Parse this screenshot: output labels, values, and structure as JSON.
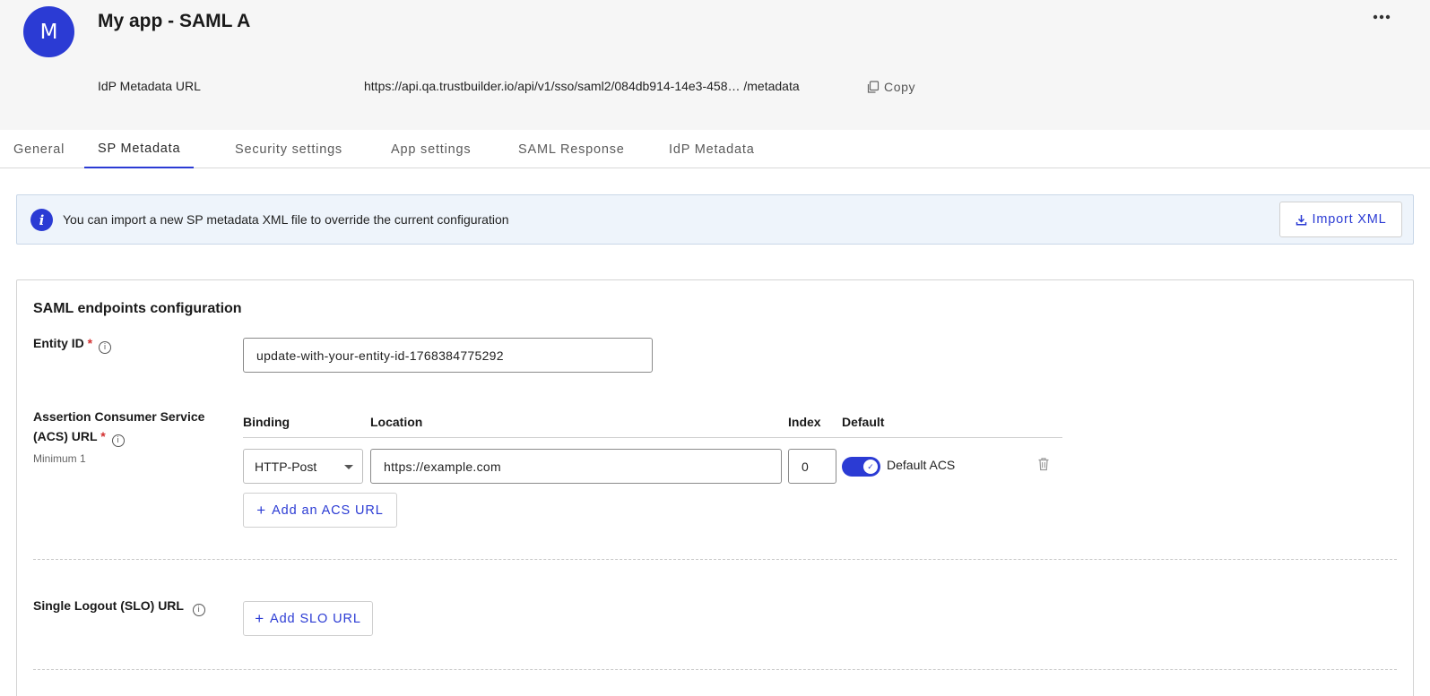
{
  "header": {
    "avatar_letter": "M",
    "app_title": "My app - SAML A",
    "more_label": "•••",
    "metadata_label": "IdP Metadata URL",
    "metadata_url": "https://api.qa.trustbuilder.io/api/v1/sso/saml2/084db914-14e3-458… /metadata",
    "copy_label": "Copy"
  },
  "tabs": [
    {
      "label": "General",
      "active": false
    },
    {
      "label": "SP Metadata",
      "active": true
    },
    {
      "label": "Security settings",
      "active": false
    },
    {
      "label": "App settings",
      "active": false
    },
    {
      "label": "SAML Response",
      "active": false
    },
    {
      "label": "IdP Metadata",
      "active": false
    }
  ],
  "banner": {
    "icon": "info-icon",
    "text": "You can import a new SP metadata XML file to override the current configuration",
    "import_label": "Import XML"
  },
  "card": {
    "title": "SAML endpoints configuration",
    "entity_id": {
      "label": "Entity ID",
      "required_mark": "*",
      "value": "update-with-your-entity-id-1768384775292"
    },
    "acs": {
      "label_line1": "Assertion Consumer Service",
      "label_line2": "(ACS) URL",
      "required_mark": "*",
      "sublabel": "Minimum 1",
      "columns": {
        "binding": "Binding",
        "location": "Location",
        "index": "Index",
        "default": "Default"
      },
      "row": {
        "binding": "HTTP-Post",
        "location": "https://example.com",
        "index": "0",
        "default_on": true,
        "default_label": "Default ACS"
      },
      "add_label": "Add an ACS URL"
    },
    "slo": {
      "label": "Single Logout (SLO) URL",
      "add_label": "Add SLO URL"
    }
  },
  "colors": {
    "accent": "#2b3bd4",
    "required": "#d32f2f",
    "banner_bg": "#eef4fb"
  }
}
